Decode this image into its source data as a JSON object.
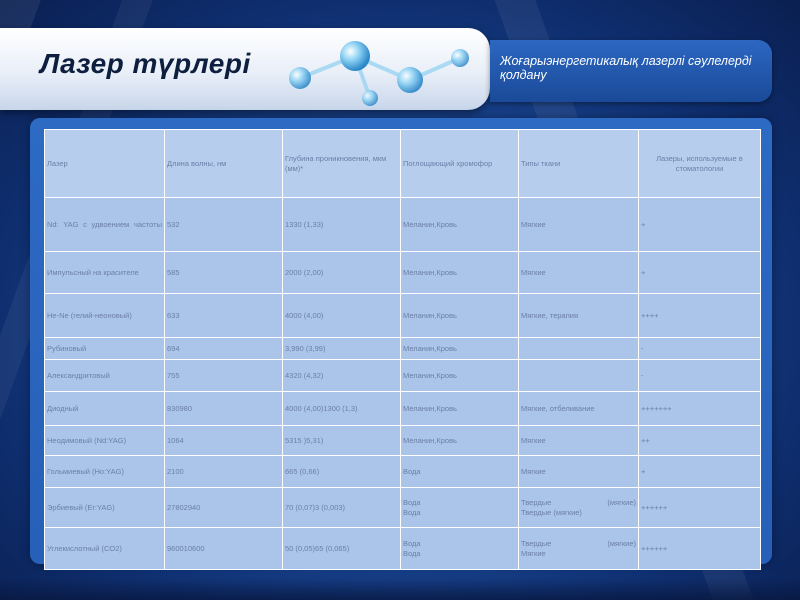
{
  "slide": {
    "title": "Лазер түрлері",
    "subtitle": "Жоғарыэнергетикалық лазерлі сәулелерді қолдану"
  },
  "table": {
    "headers": [
      "Лазер",
      "Длина волны, нм",
      "Глубина проникновения, мкм (мм)*",
      "Поглощающий хромофор",
      "Типы ткани",
      "Лазеры, используемые в стоматологии"
    ],
    "rows": [
      {
        "laser": "Nd: YAG с удвоением частоты",
        "wavelength": "532",
        "depth": "1330 (1,33)",
        "chromophore": "Меланин,Кровь",
        "tissue": "Мягкие",
        "dental": "+"
      },
      {
        "laser": "Импульсный на красителе",
        "wavelength": "585",
        "depth": "2000 (2,00)",
        "chromophore": "Меланин,Кровь",
        "tissue": "Мягкие",
        "dental": "+"
      },
      {
        "laser": "He-Ne (гелий-неоновый)",
        "wavelength": "633",
        "depth": "4000 (4,00)",
        "chromophore": "Меланин,Кровь",
        "tissue": "Мягкие, терапия",
        "dental": "++++"
      },
      {
        "laser": "Рубиновый",
        "wavelength": "694",
        "depth": "3,990 (3,99)",
        "chromophore": "Меланин,Кровь",
        "tissue": "",
        "dental": "-"
      },
      {
        "laser": "Александритовый",
        "wavelength": "755",
        "depth": "4320 (4,32)",
        "chromophore": "Меланин,Кровь",
        "tissue": "",
        "dental": "-"
      },
      {
        "laser": "Диодный",
        "wavelength": "830980",
        "depth": "4000 (4,00)1300 (1,3)",
        "chromophore": "Меланин,Кровь",
        "tissue": "Мягкие, отбеливание",
        "dental": "+++++++"
      },
      {
        "laser": "Неодимовый (Nd:YAG)",
        "wavelength": "1064",
        "depth": "5315 )5,31)",
        "chromophore": "Меланин,Кровь",
        "tissue": "Мягкие",
        "dental": "++"
      },
      {
        "laser": "Гольмиевый (Ho:YAG)",
        "wavelength": "2100",
        "depth": "665 (0,66)",
        "chromophore": "Вода",
        "tissue": "Мягкие",
        "dental": "+"
      },
      {
        "laser": "Эрбиевый (Er:YAG)",
        "wavelength": "27802940",
        "depth": "70 (0,07)3 (0,003)",
        "chromophore": [
          "Вода",
          "Вода"
        ],
        "tissue": [
          "Твердые (мягкие)",
          "Твердые (мягкие)"
        ],
        "dental": "++++++"
      },
      {
        "laser": "Углекислотный (CO2)",
        "wavelength": "960010600",
        "depth": "50 (0,05)65 (0,065)",
        "chromophore": [
          "Вода",
          "Вода"
        ],
        "tissue": [
          "Твердые (мягкие)",
          "Мягкие"
        ],
        "dental": "++++++"
      }
    ]
  }
}
